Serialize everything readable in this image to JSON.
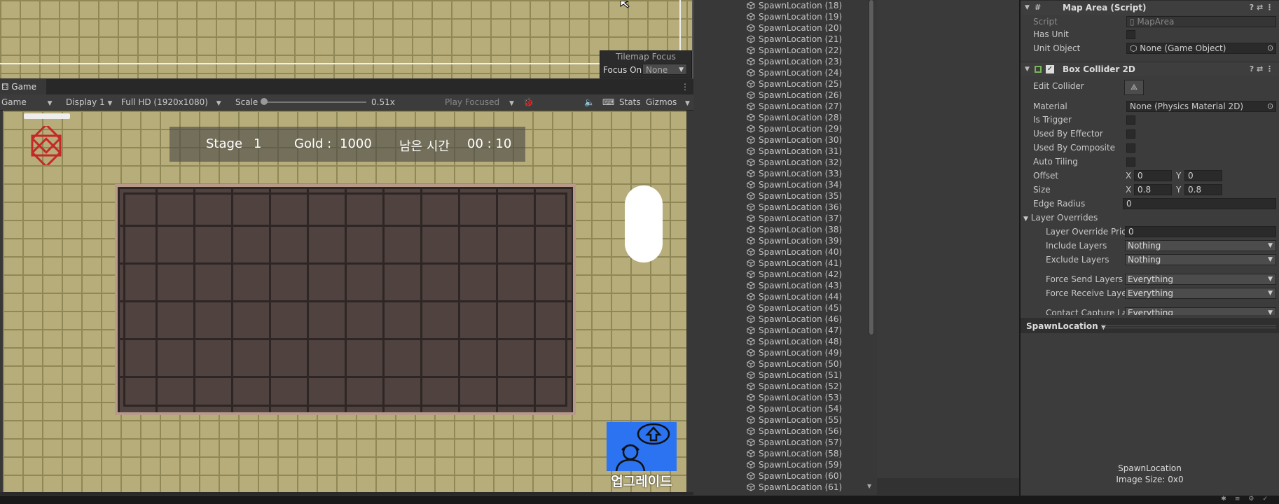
{
  "scene": {
    "tilemap_focus": {
      "title": "Tilemap Focus",
      "label": "Focus On",
      "value": "None"
    }
  },
  "game": {
    "tab_label": "Game",
    "toolbar": {
      "view_select": "Game",
      "display": "Display 1",
      "resolution": "Full HD (1920x1080)",
      "scale_label": "Scale",
      "scale_value": "0.51x",
      "play_mode": "Play Focused",
      "stats": "Stats",
      "gizmos": "Gizmos"
    },
    "hud": {
      "stage_label": "Stage",
      "stage_value": "1",
      "gold_label": "Gold :",
      "gold_value": "1000",
      "time_label": "남은 시간",
      "time_value": "00 : 10"
    },
    "upgrade_label": "업그레이드",
    "colors": {
      "upgrade_bg": "#2b73f0",
      "tile": "#b7ad7a",
      "board": "#4f423f"
    }
  },
  "hierarchy": {
    "icon": "gameobject-cube-icon",
    "items": [
      "SpawnLocation (18)",
      "SpawnLocation (19)",
      "SpawnLocation (20)",
      "SpawnLocation (21)",
      "SpawnLocation (22)",
      "SpawnLocation (23)",
      "SpawnLocation (24)",
      "SpawnLocation (25)",
      "SpawnLocation (26)",
      "SpawnLocation (27)",
      "SpawnLocation (28)",
      "SpawnLocation (29)",
      "SpawnLocation (30)",
      "SpawnLocation (31)",
      "SpawnLocation (32)",
      "SpawnLocation (33)",
      "SpawnLocation (34)",
      "SpawnLocation (35)",
      "SpawnLocation (36)",
      "SpawnLocation (37)",
      "SpawnLocation (38)",
      "SpawnLocation (39)",
      "SpawnLocation (40)",
      "SpawnLocation (41)",
      "SpawnLocation (42)",
      "SpawnLocation (43)",
      "SpawnLocation (44)",
      "SpawnLocation (45)",
      "SpawnLocation (46)",
      "SpawnLocation (47)",
      "SpawnLocation (48)",
      "SpawnLocation (49)",
      "SpawnLocation (50)",
      "SpawnLocation (51)",
      "SpawnLocation (52)",
      "SpawnLocation (53)",
      "SpawnLocation (54)",
      "SpawnLocation (55)",
      "SpawnLocation (56)",
      "SpawnLocation (57)",
      "SpawnLocation (58)",
      "SpawnLocation (59)",
      "SpawnLocation (60)",
      "SpawnLocation (61)"
    ]
  },
  "inspector": {
    "map_area": {
      "title": "Map Area (Script)",
      "script_label": "Script",
      "script_value": "MapArea",
      "has_unit_label": "Has Unit",
      "unit_object_label": "Unit Object",
      "unit_object_value": "None (Game Object)"
    },
    "box_collider": {
      "title": "Box Collider 2D",
      "edit_collider": "Edit Collider",
      "material_label": "Material",
      "material_value": "None (Physics Material 2D)",
      "is_trigger": "Is Trigger",
      "used_by_effector": "Used By Effector",
      "used_by_composite": "Used By Composite",
      "auto_tiling": "Auto Tiling",
      "offset_label": "Offset",
      "offset_x": "0",
      "offset_y": "0",
      "size_label": "Size",
      "size_x": "0.8",
      "size_y": "0.8",
      "x_label": "X",
      "y_label": "Y",
      "edge_radius_label": "Edge Radius",
      "edge_radius_value": "0",
      "layer_overrides": "Layer Overrides",
      "layer_override_priority_label": "Layer Override Prio",
      "layer_override_priority_value": "0",
      "include_layers_label": "Include Layers",
      "include_layers_value": "Nothing",
      "exclude_layers_label": "Exclude Layers",
      "exclude_layers_value": "Nothing",
      "force_send_label": "Force Send Layers",
      "force_send_value": "Everything",
      "force_receive_label": "Force Receive Laye",
      "force_receive_value": "Everything",
      "contact_capture_label": "Contact Capture La",
      "contact_capture_value": "Everything"
    },
    "preview": {
      "header": "SpawnLocation",
      "name": "SpawnLocation",
      "size": "Image Size: 0x0"
    }
  }
}
